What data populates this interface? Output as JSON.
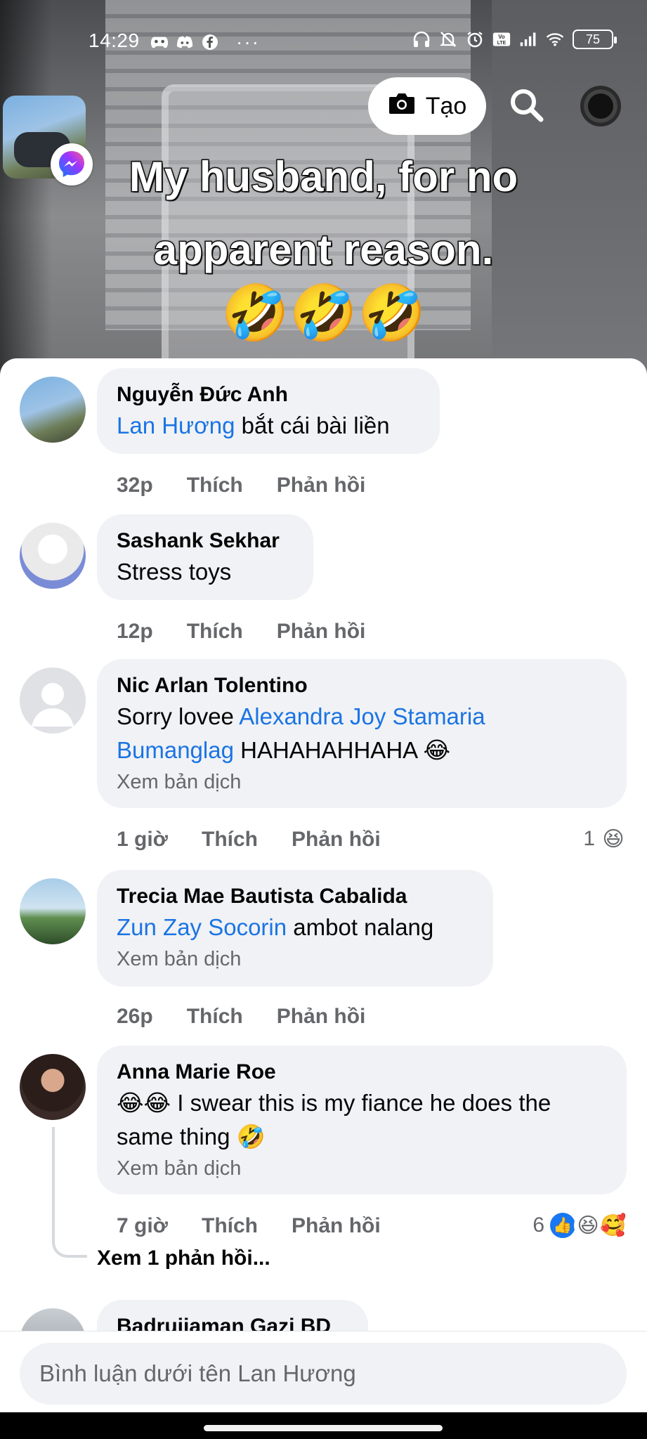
{
  "status_bar": {
    "time": "14:29",
    "more": "···",
    "battery": "75",
    "left_icons": [
      "gamepad-icon",
      "discord-icon",
      "facebook-icon"
    ],
    "right_icons": [
      "headphones-icon",
      "bell-off-icon",
      "alarm-icon",
      "volte-icon",
      "signal-icon",
      "wifi-icon",
      "battery-icon"
    ]
  },
  "header": {
    "create_label": "Tạo"
  },
  "video": {
    "caption_line1": "My husband, for no",
    "caption_line2": "apparent reason.",
    "caption_emoji": "🤣🤣🤣"
  },
  "comments": [
    {
      "name": "Nguyễn Đức Anh",
      "mention": "Lan Hương",
      "text": " bắt cái bài liền",
      "time": "32p",
      "like": "Thích",
      "reply": "Phản hồi"
    },
    {
      "name": "Sashank Sekhar",
      "text": "Stress toys",
      "time": "12p",
      "like": "Thích",
      "reply": "Phản hồi"
    },
    {
      "name": "Nic Arlan Tolentino",
      "prefix": "Sorry lovee ",
      "mention": "Alexandra Joy Stamaria Bumanglag",
      "text": " HAHAHAHHAHA 😂",
      "translate": "Xem bản dịch",
      "time": "1 giờ",
      "like": "Thích",
      "reply": "Phản hồi",
      "reaction_count": "1",
      "reaction_emoji": "😆"
    },
    {
      "name": "Trecia Mae Bautista Cabalida",
      "mention": "Zun Zay Socorin",
      "text": " ambot nalang",
      "translate": "Xem bản dịch",
      "time": "26p",
      "like": "Thích",
      "reply": "Phản hồi"
    },
    {
      "name": "Anna Marie Roe",
      "text": "😂😂 I swear this is my fiance he does the same thing 🤣",
      "translate": "Xem bản dịch",
      "time": "7 giờ",
      "like": "Thích",
      "reply": "Phản hồi",
      "reaction_count": "6",
      "reaction_emojis": [
        "👍",
        "😆",
        "🥰"
      ],
      "view_replies": "Xem 1 phản hồi..."
    },
    {
      "name": "Badrujjaman Gazi BD"
    }
  ],
  "composer": {
    "placeholder": "Bình luận dưới tên Lan Hương"
  },
  "colors": {
    "mention": "#1b74e4",
    "bubble": "#f0f2f5",
    "meta": "#65676b",
    "like_blue": "#1877f2"
  }
}
